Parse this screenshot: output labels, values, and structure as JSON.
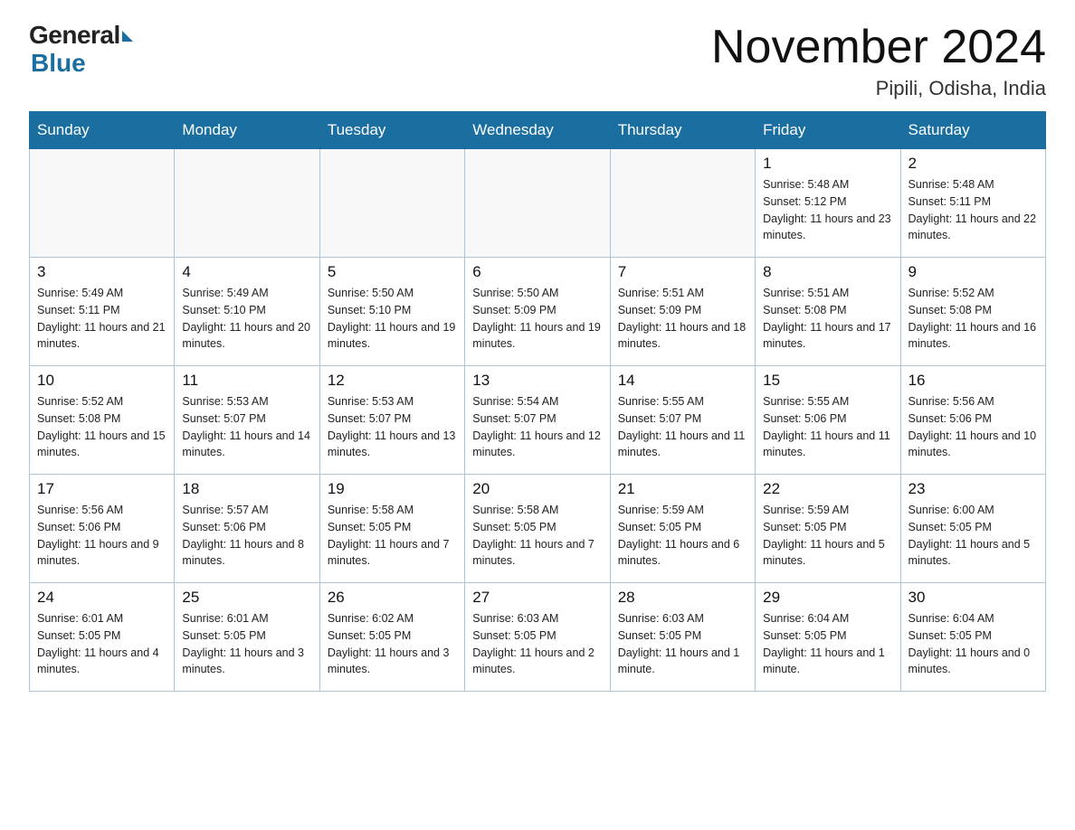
{
  "logo": {
    "general": "General",
    "blue": "Blue",
    "arrow_color": "#1a6fa0"
  },
  "header": {
    "month_title": "November 2024",
    "location": "Pipili, Odisha, India"
  },
  "weekdays": [
    "Sunday",
    "Monday",
    "Tuesday",
    "Wednesday",
    "Thursday",
    "Friday",
    "Saturday"
  ],
  "weeks": [
    [
      {
        "day": "",
        "info": ""
      },
      {
        "day": "",
        "info": ""
      },
      {
        "day": "",
        "info": ""
      },
      {
        "day": "",
        "info": ""
      },
      {
        "day": "",
        "info": ""
      },
      {
        "day": "1",
        "info": "Sunrise: 5:48 AM\nSunset: 5:12 PM\nDaylight: 11 hours and 23 minutes."
      },
      {
        "day": "2",
        "info": "Sunrise: 5:48 AM\nSunset: 5:11 PM\nDaylight: 11 hours and 22 minutes."
      }
    ],
    [
      {
        "day": "3",
        "info": "Sunrise: 5:49 AM\nSunset: 5:11 PM\nDaylight: 11 hours and 21 minutes."
      },
      {
        "day": "4",
        "info": "Sunrise: 5:49 AM\nSunset: 5:10 PM\nDaylight: 11 hours and 20 minutes."
      },
      {
        "day": "5",
        "info": "Sunrise: 5:50 AM\nSunset: 5:10 PM\nDaylight: 11 hours and 19 minutes."
      },
      {
        "day": "6",
        "info": "Sunrise: 5:50 AM\nSunset: 5:09 PM\nDaylight: 11 hours and 19 minutes."
      },
      {
        "day": "7",
        "info": "Sunrise: 5:51 AM\nSunset: 5:09 PM\nDaylight: 11 hours and 18 minutes."
      },
      {
        "day": "8",
        "info": "Sunrise: 5:51 AM\nSunset: 5:08 PM\nDaylight: 11 hours and 17 minutes."
      },
      {
        "day": "9",
        "info": "Sunrise: 5:52 AM\nSunset: 5:08 PM\nDaylight: 11 hours and 16 minutes."
      }
    ],
    [
      {
        "day": "10",
        "info": "Sunrise: 5:52 AM\nSunset: 5:08 PM\nDaylight: 11 hours and 15 minutes."
      },
      {
        "day": "11",
        "info": "Sunrise: 5:53 AM\nSunset: 5:07 PM\nDaylight: 11 hours and 14 minutes."
      },
      {
        "day": "12",
        "info": "Sunrise: 5:53 AM\nSunset: 5:07 PM\nDaylight: 11 hours and 13 minutes."
      },
      {
        "day": "13",
        "info": "Sunrise: 5:54 AM\nSunset: 5:07 PM\nDaylight: 11 hours and 12 minutes."
      },
      {
        "day": "14",
        "info": "Sunrise: 5:55 AM\nSunset: 5:07 PM\nDaylight: 11 hours and 11 minutes."
      },
      {
        "day": "15",
        "info": "Sunrise: 5:55 AM\nSunset: 5:06 PM\nDaylight: 11 hours and 11 minutes."
      },
      {
        "day": "16",
        "info": "Sunrise: 5:56 AM\nSunset: 5:06 PM\nDaylight: 11 hours and 10 minutes."
      }
    ],
    [
      {
        "day": "17",
        "info": "Sunrise: 5:56 AM\nSunset: 5:06 PM\nDaylight: 11 hours and 9 minutes."
      },
      {
        "day": "18",
        "info": "Sunrise: 5:57 AM\nSunset: 5:06 PM\nDaylight: 11 hours and 8 minutes."
      },
      {
        "day": "19",
        "info": "Sunrise: 5:58 AM\nSunset: 5:05 PM\nDaylight: 11 hours and 7 minutes."
      },
      {
        "day": "20",
        "info": "Sunrise: 5:58 AM\nSunset: 5:05 PM\nDaylight: 11 hours and 7 minutes."
      },
      {
        "day": "21",
        "info": "Sunrise: 5:59 AM\nSunset: 5:05 PM\nDaylight: 11 hours and 6 minutes."
      },
      {
        "day": "22",
        "info": "Sunrise: 5:59 AM\nSunset: 5:05 PM\nDaylight: 11 hours and 5 minutes."
      },
      {
        "day": "23",
        "info": "Sunrise: 6:00 AM\nSunset: 5:05 PM\nDaylight: 11 hours and 5 minutes."
      }
    ],
    [
      {
        "day": "24",
        "info": "Sunrise: 6:01 AM\nSunset: 5:05 PM\nDaylight: 11 hours and 4 minutes."
      },
      {
        "day": "25",
        "info": "Sunrise: 6:01 AM\nSunset: 5:05 PM\nDaylight: 11 hours and 3 minutes."
      },
      {
        "day": "26",
        "info": "Sunrise: 6:02 AM\nSunset: 5:05 PM\nDaylight: 11 hours and 3 minutes."
      },
      {
        "day": "27",
        "info": "Sunrise: 6:03 AM\nSunset: 5:05 PM\nDaylight: 11 hours and 2 minutes."
      },
      {
        "day": "28",
        "info": "Sunrise: 6:03 AM\nSunset: 5:05 PM\nDaylight: 11 hours and 1 minute."
      },
      {
        "day": "29",
        "info": "Sunrise: 6:04 AM\nSunset: 5:05 PM\nDaylight: 11 hours and 1 minute."
      },
      {
        "day": "30",
        "info": "Sunrise: 6:04 AM\nSunset: 5:05 PM\nDaylight: 11 hours and 0 minutes."
      }
    ]
  ]
}
